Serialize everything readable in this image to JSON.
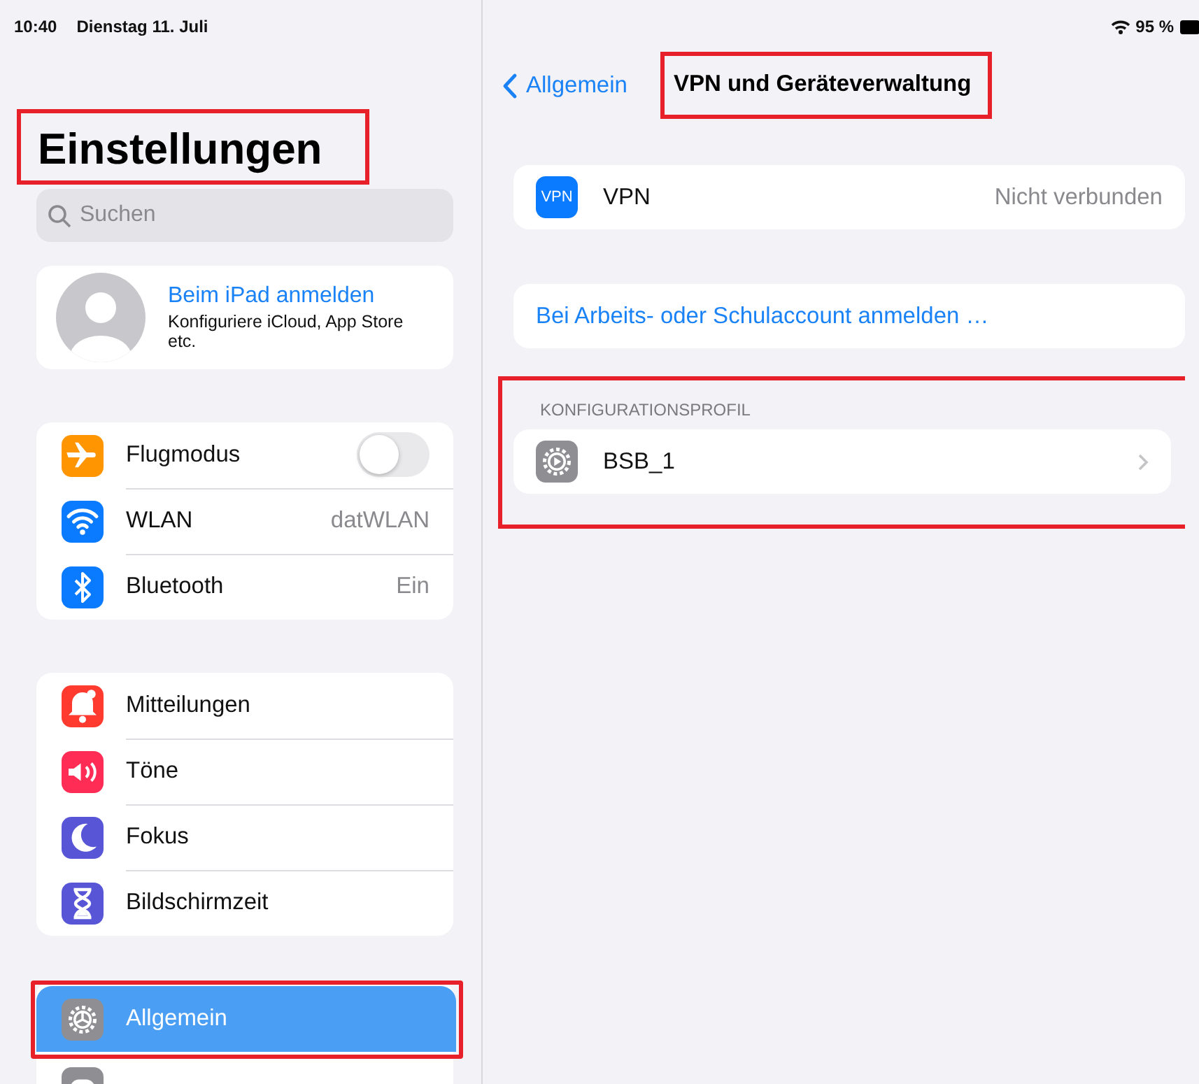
{
  "status_bar": {
    "time": "10:40",
    "date": "Dienstag 11. Juli",
    "battery": "95 %"
  },
  "sidebar": {
    "title": "Einstellungen",
    "title_highlighted": true,
    "search": {
      "placeholder": "Suchen"
    },
    "account": {
      "title": "Beim iPad anmelden",
      "subtitle": "Konfiguriere iCloud, App Store etc."
    },
    "groups": [
      {
        "items": [
          {
            "kind": "toggle",
            "label": "Flugmodus",
            "on": false,
            "color": "#ff9500",
            "selected": false
          },
          {
            "kind": "value",
            "label": "WLAN",
            "value": "datWLAN",
            "color": "#0a7aff",
            "selected": false
          },
          {
            "kind": "value",
            "label": "Bluetooth",
            "value": "Ein",
            "color": "#0a7aff",
            "selected": false
          }
        ]
      },
      {
        "items": [
          {
            "kind": "plain",
            "label": "Mitteilungen",
            "color": "#ff3b30",
            "selected": false
          },
          {
            "kind": "plain",
            "label": "Töne",
            "color": "#ff2d55",
            "selected": false
          },
          {
            "kind": "plain",
            "label": "Fokus",
            "color": "#5856d6",
            "selected": false
          },
          {
            "kind": "plain",
            "label": "Bildschirmzeit",
            "color": "#5856d6",
            "selected": false
          }
        ]
      },
      {
        "items": [
          {
            "kind": "plain",
            "label": "Allgemein",
            "color": "#8e8e93",
            "selected": true,
            "highlighted": true
          },
          {
            "kind": "cut",
            "color": "#8e8e93",
            "selected": false
          }
        ]
      }
    ]
  },
  "detail": {
    "back": "Allgemein",
    "title": "VPN und Geräteverwaltung",
    "title_highlighted": true,
    "vpn": {
      "badge": "VPN",
      "label": "VPN",
      "status": "Nicht verbunden"
    },
    "signin_link": "Bei Arbeits- oder Schulaccount anmelden …",
    "profile_section": {
      "header": "KONFIGURATIONSPROFIL",
      "highlighted": true,
      "items": [
        {
          "label": "BSB_1"
        }
      ]
    }
  }
}
